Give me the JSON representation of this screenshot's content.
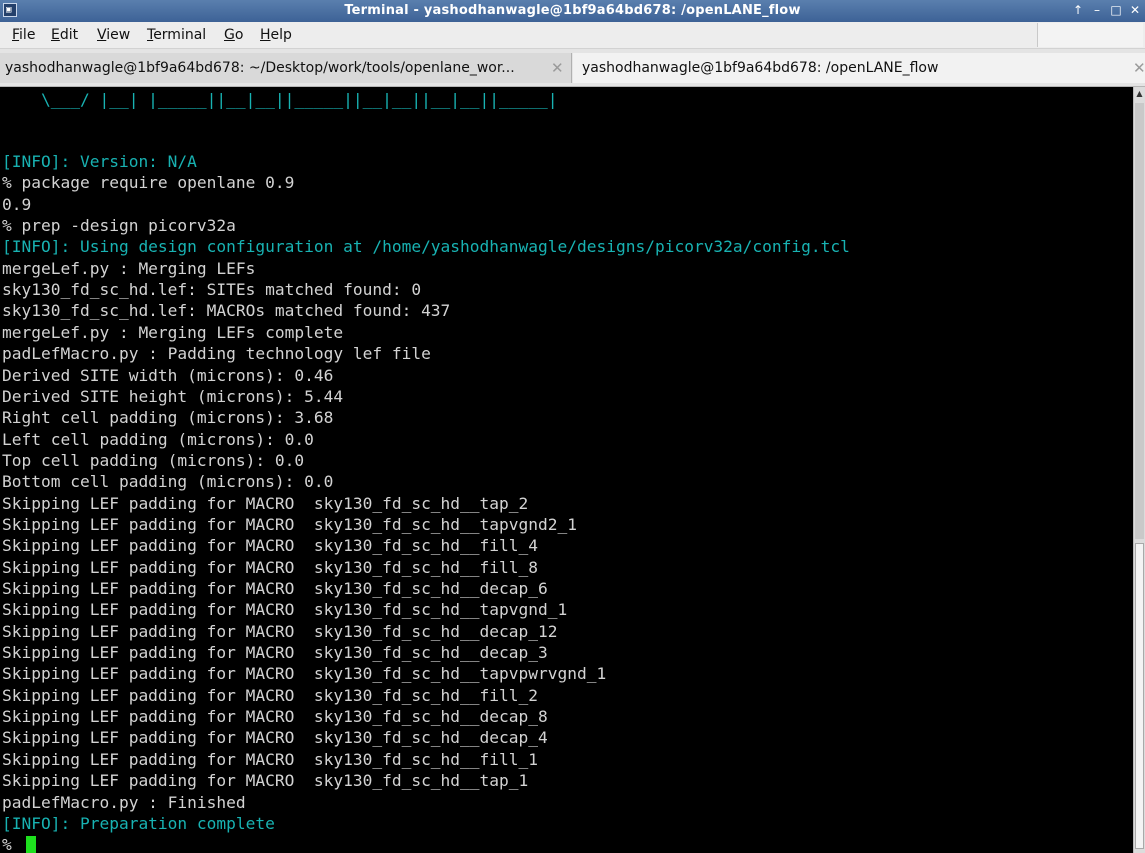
{
  "window": {
    "title": "Terminal - yashodhanwagle@1bf9a64bd678: /openLANE_flow",
    "app_icon_glyph": "▣",
    "controls": {
      "pin": "↑",
      "minimize": "–",
      "maximize": "□",
      "close": "✕"
    }
  },
  "menu": {
    "file": {
      "mnemonic": "F",
      "rest": "ile"
    },
    "edit": {
      "mnemonic": "E",
      "rest": "dit"
    },
    "view": {
      "mnemonic": "V",
      "rest": "iew"
    },
    "terminal": {
      "mnemonic": "T",
      "rest": "erminal"
    },
    "go": {
      "mnemonic": "G",
      "rest": "o"
    },
    "help": {
      "mnemonic": "H",
      "rest": "elp"
    }
  },
  "tabs": [
    {
      "label": "yashodhanwagle@1bf9a64bd678: ~/Desktop/work/tools/openlane_wor...",
      "close": "✕",
      "active": false
    },
    {
      "label": "yashodhanwagle@1bf9a64bd678: /openLANE_flow",
      "close": "✕",
      "active": true
    }
  ],
  "terminal": {
    "ascii_art": "    \\___/ |__| |_____||__|__||_____||__|__||__|__||_____|",
    "lines": [
      "[INFO]: Version: N/A",
      "% package require openlane 0.9",
      "0.9",
      "% prep -design picorv32a",
      "[INFO]: Using design configuration at /home/yashodhanwagle/designs/picorv32a/config.tcl",
      "mergeLef.py : Merging LEFs",
      "sky130_fd_sc_hd.lef: SITEs matched found: 0",
      "sky130_fd_sc_hd.lef: MACROs matched found: 437",
      "mergeLef.py : Merging LEFs complete",
      "padLefMacro.py : Padding technology lef file",
      "Derived SITE width (microns): 0.46",
      "Derived SITE height (microns): 5.44",
      "Right cell padding (microns): 3.68",
      "Left cell padding (microns): 0.0",
      "Top cell padding (microns): 0.0",
      "Bottom cell padding (microns): 0.0",
      "Skipping LEF padding for MACRO  sky130_fd_sc_hd__tap_2",
      "Skipping LEF padding for MACRO  sky130_fd_sc_hd__tapvgnd2_1",
      "Skipping LEF padding for MACRO  sky130_fd_sc_hd__fill_4",
      "Skipping LEF padding for MACRO  sky130_fd_sc_hd__fill_8",
      "Skipping LEF padding for MACRO  sky130_fd_sc_hd__decap_6",
      "Skipping LEF padding for MACRO  sky130_fd_sc_hd__tapvgnd_1",
      "Skipping LEF padding for MACRO  sky130_fd_sc_hd__decap_12",
      "Skipping LEF padding for MACRO  sky130_fd_sc_hd__decap_3",
      "Skipping LEF padding for MACRO  sky130_fd_sc_hd__tapvpwrvgnd_1",
      "Skipping LEF padding for MACRO  sky130_fd_sc_hd__fill_2",
      "Skipping LEF padding for MACRO  sky130_fd_sc_hd__decap_8",
      "Skipping LEF padding for MACRO  sky130_fd_sc_hd__decap_4",
      "Skipping LEF padding for MACRO  sky130_fd_sc_hd__fill_1",
      "Skipping LEF padding for MACRO  sky130_fd_sc_hd__tap_1",
      "padLefMacro.py : Finished",
      "[INFO]: Preparation complete"
    ],
    "prompt": "% "
  },
  "colors": {
    "info": "#18b2b2",
    "text": "#d3d3d3",
    "cursor": "#1ee01e",
    "background": "#000000",
    "titlebar": "#4a70a3"
  }
}
